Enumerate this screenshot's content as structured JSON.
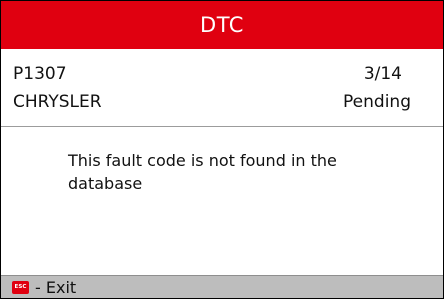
{
  "header": {
    "title": "DTC"
  },
  "dtc": {
    "code": "P1307",
    "position": "3/14",
    "manufacturer": "CHRYSLER",
    "status": "Pending"
  },
  "message": {
    "text": "This fault code is not found in the database"
  },
  "footer": {
    "esc_icon_text": "ESC",
    "exit_label": "- Exit"
  },
  "colors": {
    "header_background": "#e00010",
    "footer_background": "#bdbdbd",
    "esc_icon": "#e00010"
  }
}
